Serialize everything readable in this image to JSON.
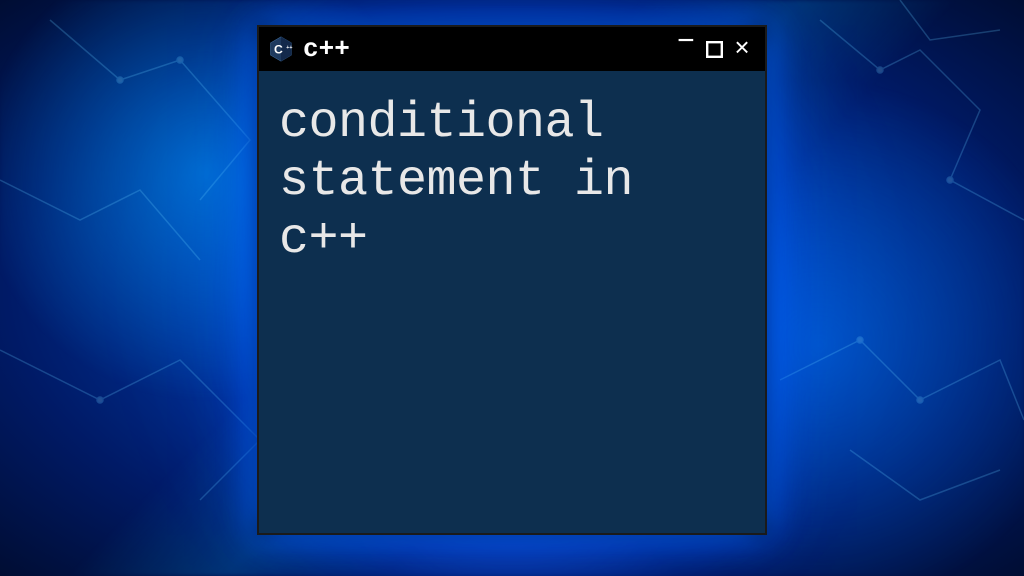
{
  "window": {
    "title": "c++",
    "icon_name": "cpp-hexagon-icon"
  },
  "body": {
    "content": "conditional statement in c++"
  },
  "colors": {
    "terminal_bg": "#0d2f4f",
    "titlebar_bg": "#000000",
    "text": "#e8e8e8"
  }
}
